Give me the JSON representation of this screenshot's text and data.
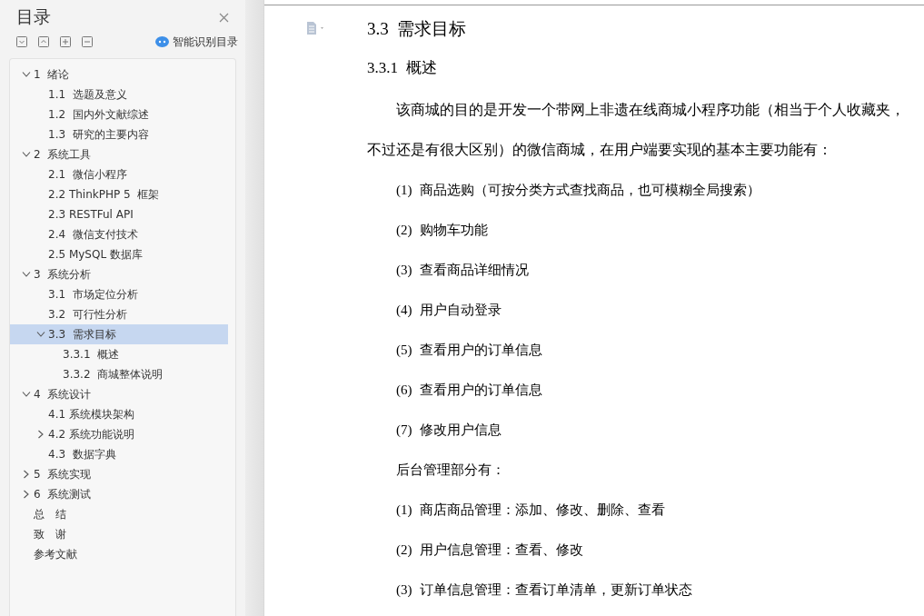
{
  "sidebar": {
    "title": "目录",
    "smart_toc_label": "智能识别目录",
    "toc": [
      {
        "label": "1  绪论",
        "expanded": true,
        "selected": false,
        "children": [
          {
            "label": "1.1  选题及意义",
            "selected": false
          },
          {
            "label": "1.2  国内外文献综述",
            "selected": false
          },
          {
            "label": "1.3  研究的主要内容",
            "selected": false
          }
        ]
      },
      {
        "label": "2  系统工具",
        "expanded": true,
        "selected": false,
        "children": [
          {
            "label": "2.1  微信小程序",
            "selected": false
          },
          {
            "label": "2.2 ThinkPHP 5  框架",
            "selected": false
          },
          {
            "label": "2.3 RESTFul API",
            "selected": false
          },
          {
            "label": "2.4  微信支付技术",
            "selected": false
          },
          {
            "label": "2.5 MySQL 数据库",
            "selected": false
          }
        ]
      },
      {
        "label": "3  系统分析",
        "expanded": true,
        "selected": false,
        "children": [
          {
            "label": "3.1  市场定位分析",
            "selected": false
          },
          {
            "label": "3.2  可行性分析",
            "selected": false
          },
          {
            "label": "3.3  需求目标",
            "expanded": true,
            "selected": true,
            "children": [
              {
                "label": "3.3.1  概述",
                "selected": false
              },
              {
                "label": "3.3.2  商城整体说明",
                "selected": false
              }
            ]
          }
        ]
      },
      {
        "label": "4  系统设计",
        "expanded": true,
        "selected": false,
        "children": [
          {
            "label": "4.1 系统模块架构",
            "selected": false
          },
          {
            "label": "4.2 系统功能说明",
            "expanded": false,
            "selected": false
          },
          {
            "label": "4.3  数据字典",
            "selected": false
          }
        ]
      },
      {
        "label": "5  系统实现",
        "expanded": false,
        "selected": false
      },
      {
        "label": "6  系统测试",
        "expanded": false,
        "selected": false
      },
      {
        "label": "总　结",
        "selected": false
      },
      {
        "label": "致　谢",
        "selected": false
      },
      {
        "label": "参考文献",
        "selected": false
      }
    ]
  },
  "document": {
    "blocks": [
      {
        "kind": "heading2",
        "text": "3.3  需求目标"
      },
      {
        "kind": "heading3",
        "text": "3.3.1  概述"
      },
      {
        "kind": "paragraph",
        "text": "该商城的目的是开发一个带网上非遗在线商城小程序功能（相当于个人收藏夹，不过还是有很大区别）的微信商城，在用户端要实现的基本主要功能有："
      },
      {
        "kind": "list_item",
        "number": "(1)",
        "text": "商品选购（可按分类方式查找商品，也可模糊全局搜索）"
      },
      {
        "kind": "list_item",
        "number": "(2)",
        "text": "购物车功能"
      },
      {
        "kind": "list_item",
        "number": "(3)",
        "text": "查看商品详细情况"
      },
      {
        "kind": "list_item",
        "number": "(4)",
        "text": "用户自动登录"
      },
      {
        "kind": "list_item",
        "number": "(5)",
        "text": "查看用户的订单信息"
      },
      {
        "kind": "list_item",
        "number": "(6)",
        "text": "查看用户的订单信息"
      },
      {
        "kind": "list_item",
        "number": "(7)",
        "text": "修改用户信息"
      },
      {
        "kind": "indented",
        "text": "后台管理部分有："
      },
      {
        "kind": "list_item",
        "number": "(1)",
        "text": "商店商品管理：添加、修改、删除、查看"
      },
      {
        "kind": "list_item",
        "number": "(2)",
        "text": "用户信息管理：查看、修改"
      },
      {
        "kind": "list_item",
        "number": "(3)",
        "text": "订单信息管理：查看订单清单，更新订单状态"
      }
    ]
  }
}
